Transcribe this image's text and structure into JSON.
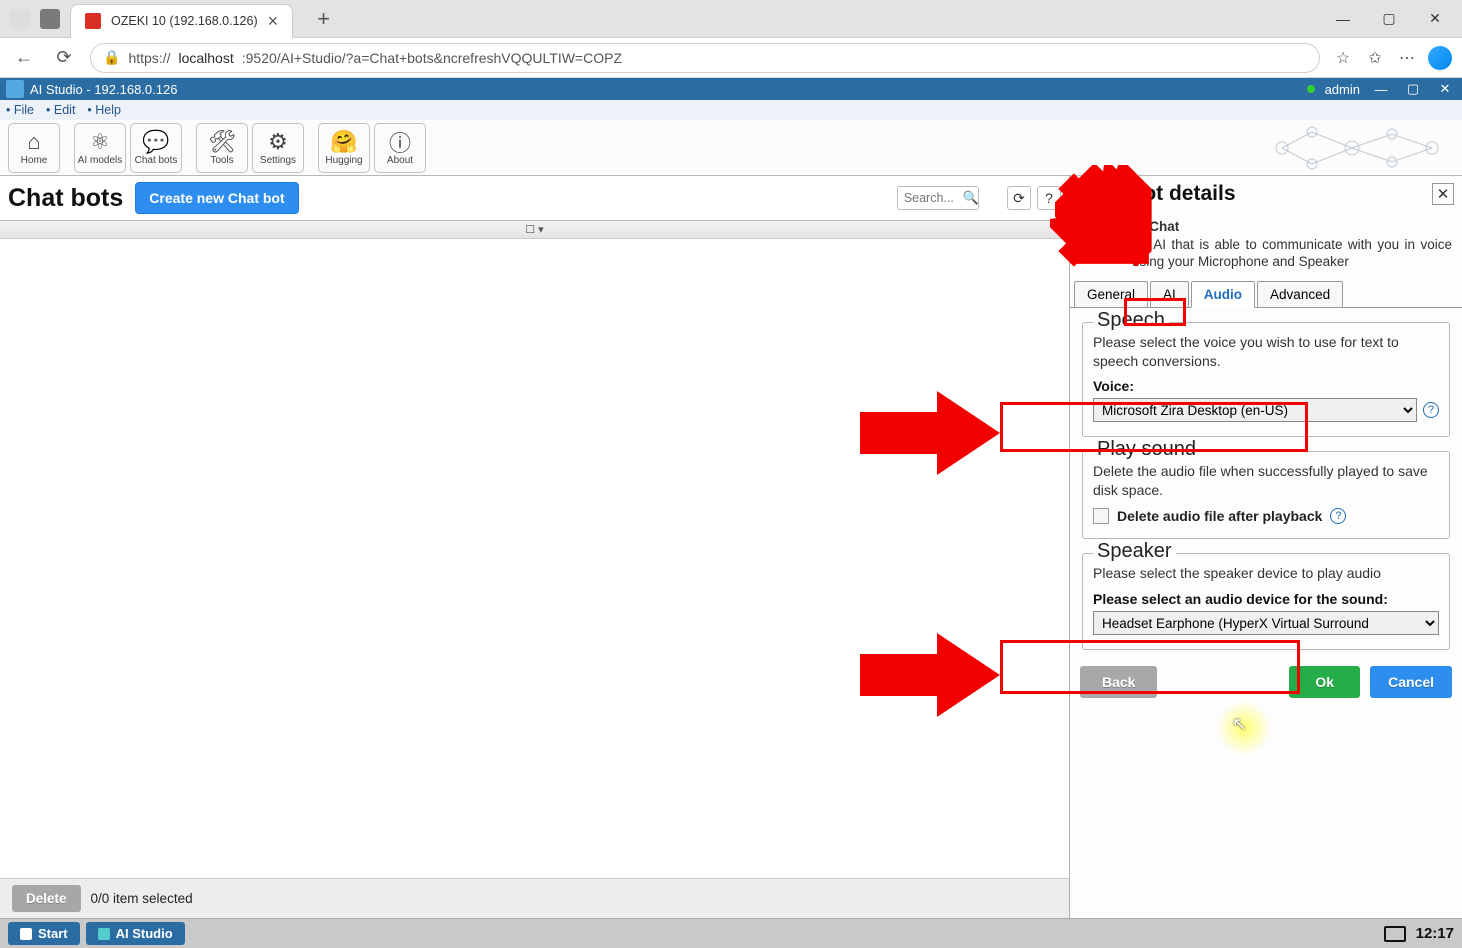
{
  "browser": {
    "tab_title": "OZEKI 10 (192.168.0.126)",
    "url_prefix": "https://",
    "url_domain": "localhost",
    "url_rest": ":9520/AI+Studio/?a=Chat+bots&ncrefreshVQQULTIW=COPZ"
  },
  "app": {
    "title": "AI Studio - 192.168.0.126",
    "user": "admin"
  },
  "menu": {
    "file": "File",
    "edit": "Edit",
    "help": "Help"
  },
  "toolbar": {
    "home": "Home",
    "ai_models": "AI models",
    "chat_bots": "Chat bots",
    "tools": "Tools",
    "settings": "Settings",
    "hugging": "Hugging",
    "about": "About"
  },
  "left": {
    "title": "Chat bots",
    "create_btn": "Create new Chat bot",
    "search_placeholder": "Search...",
    "delete_btn": "Delete",
    "selection": "0/0 item selected"
  },
  "right": {
    "title": "Chat bot details",
    "desc_title": "AI Chat",
    "desc_body": "An AI that is able to communicate with you in voice using your Microphone and Speaker",
    "tabs": {
      "general": "General",
      "ai": "AI",
      "audio": "Audio",
      "advanced": "Advanced"
    },
    "speech": {
      "legend": "Speech",
      "desc": "Please select the voice you wish to use for text to speech conversions.",
      "label": "Voice:",
      "value": "Microsoft Zira Desktop (en-US)"
    },
    "playsound": {
      "legend": "Play sound",
      "desc": "Delete the audio file when successfully played to save disk space.",
      "chk_label": "Delete audio file after playback"
    },
    "speaker": {
      "legend": "Speaker",
      "desc": "Please select the speaker device to play audio",
      "label": "Please select an audio device for the sound:",
      "value": "Headset Earphone (HyperX Virtual Surround"
    },
    "buttons": {
      "back": "Back",
      "ok": "Ok",
      "cancel": "Cancel"
    }
  },
  "taskbar": {
    "start": "Start",
    "ai_studio": "AI Studio",
    "clock": "12:17"
  }
}
